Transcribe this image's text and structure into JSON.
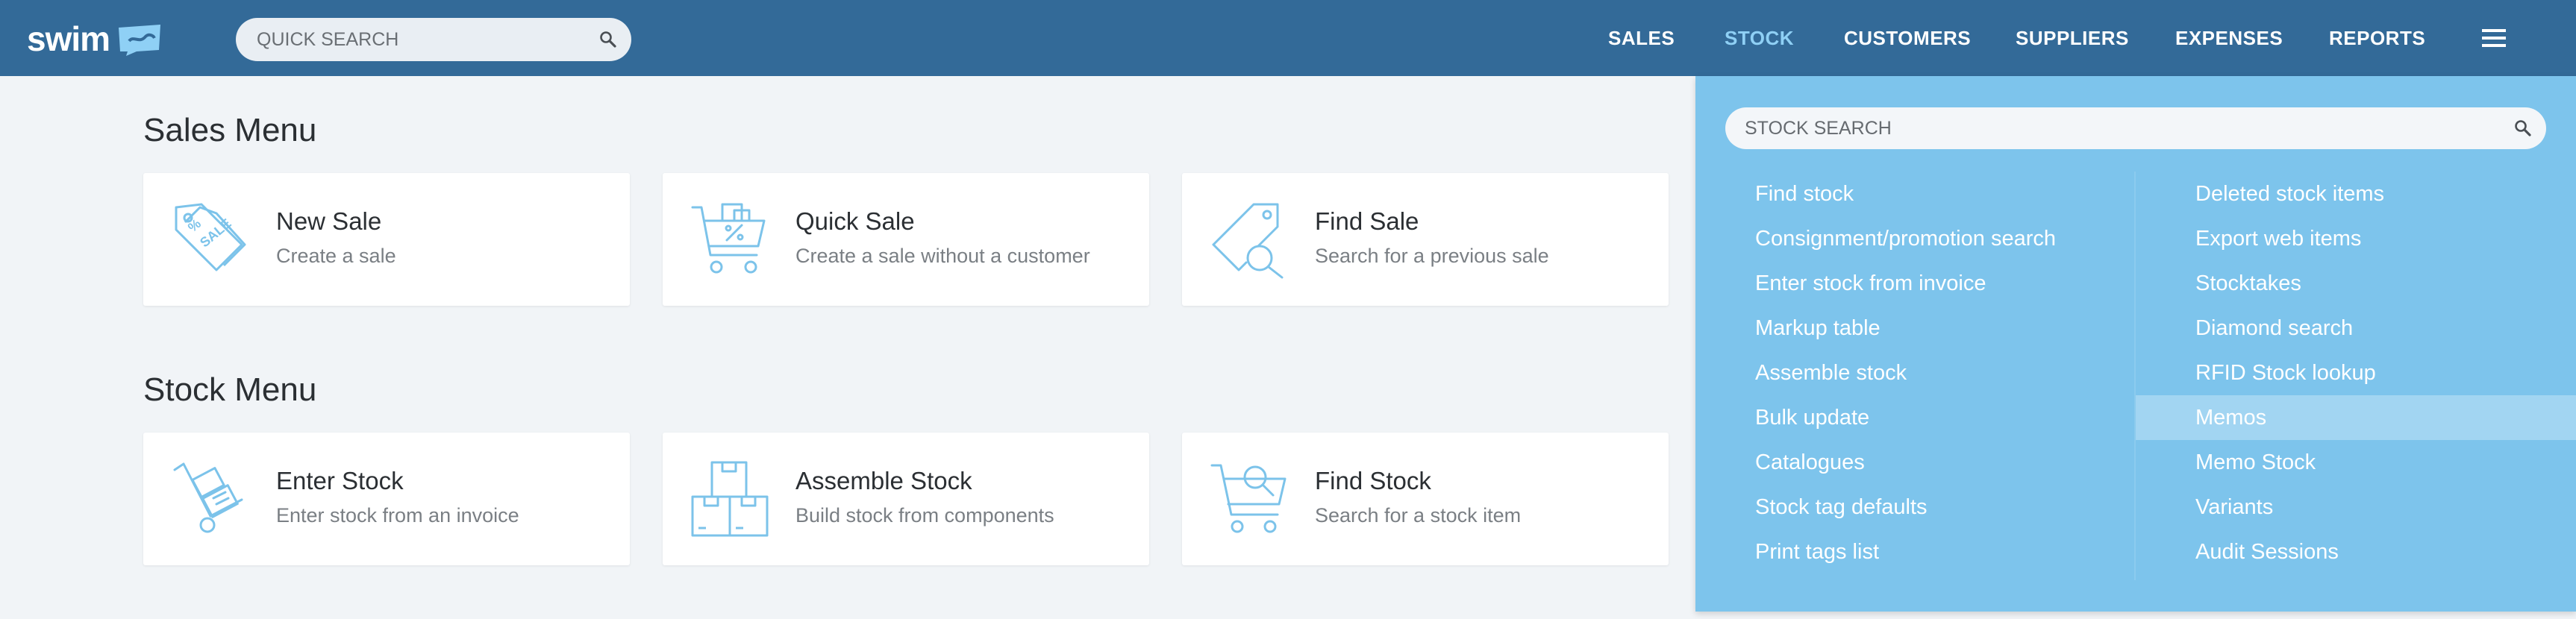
{
  "header": {
    "logo_text": "swim",
    "search": {
      "placeholder": "QUICK SEARCH",
      "value": ""
    },
    "nav": [
      {
        "label": "SALES",
        "active": false
      },
      {
        "label": "STOCK",
        "active": true
      },
      {
        "label": "CUSTOMERS",
        "active": false
      },
      {
        "label": "SUPPLIERS",
        "active": false
      },
      {
        "label": "EXPENSES",
        "active": false
      },
      {
        "label": "REPORTS",
        "active": false
      }
    ]
  },
  "sales_menu": {
    "title": "Sales Menu",
    "cards": [
      {
        "title": "New Sale",
        "subtitle": "Create a sale",
        "icon": "sale-tag-icon"
      },
      {
        "title": "Quick Sale",
        "subtitle": "Create a sale without a customer",
        "icon": "shopping-cart-icon"
      },
      {
        "title": "Find Sale",
        "subtitle": "Search for a previous sale",
        "icon": "tag-search-icon"
      }
    ]
  },
  "stock_menu": {
    "title": "Stock Menu",
    "cards": [
      {
        "title": "Enter Stock",
        "subtitle": "Enter stock from an invoice",
        "icon": "hand-truck-icon"
      },
      {
        "title": "Assemble Stock",
        "subtitle": "Build stock from components",
        "icon": "boxes-icon"
      },
      {
        "title": "Find Stock",
        "subtitle": "Search for a stock item",
        "icon": "cart-search-icon"
      }
    ]
  },
  "stock_dropdown": {
    "search": {
      "placeholder": "STOCK SEARCH",
      "value": ""
    },
    "left_items": [
      "Find stock",
      "Consignment/promotion search",
      "Enter stock from invoice",
      "Markup table",
      "Assemble stock",
      "Bulk update",
      "Catalogues",
      "Stock tag defaults",
      "Print tags list"
    ],
    "right_items": [
      "Deleted stock items",
      "Export web items",
      "Stocktakes",
      "Diamond search",
      "RFID Stock lookup",
      "Memos",
      "Memo Stock",
      "Variants",
      "Audit Sessions"
    ],
    "highlighted_item": "Memos"
  },
  "colors": {
    "header_bg": "#336a98",
    "nav_active": "#8fd0f5",
    "dropdown_bg": "#7dc4ec",
    "icon_stroke": "#7cc3ea"
  }
}
